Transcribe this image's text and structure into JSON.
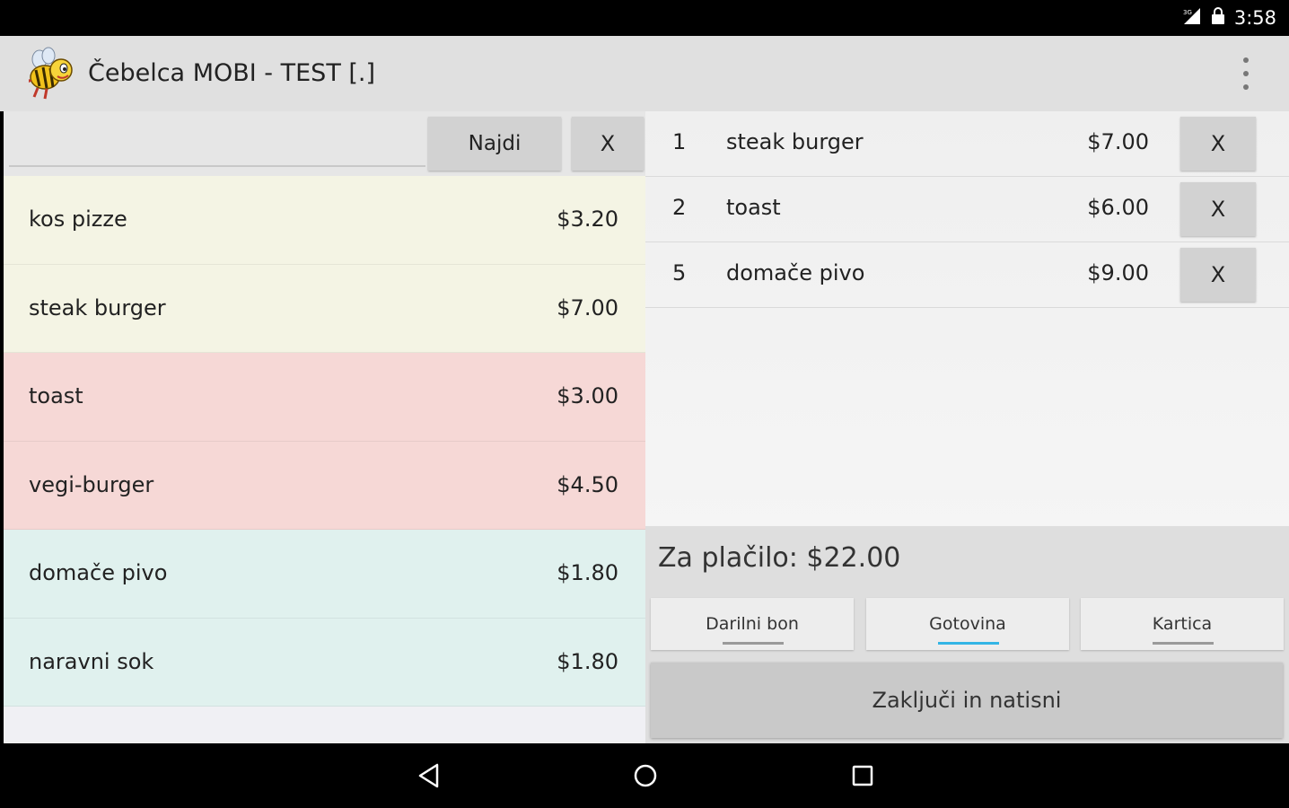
{
  "status_bar": {
    "time": "3:58",
    "signal_icon": "signal-icon",
    "lock_icon": "lock-icon"
  },
  "app_bar": {
    "title": "Čebelca MOBI - TEST [.]",
    "logo_icon": "bee-logo-icon",
    "menu_icon": "overflow-menu-icon"
  },
  "search": {
    "value": "",
    "placeholder": "",
    "find_label": "Najdi",
    "clear_label": "X"
  },
  "products": [
    {
      "name": "kos pizze",
      "price": "$3.20",
      "color": "#f4f4e4"
    },
    {
      "name": "steak burger",
      "price": "$7.00",
      "color": "#f4f4e4"
    },
    {
      "name": "toast",
      "price": "$3.00",
      "color": "#f6d8d6"
    },
    {
      "name": "vegi-burger",
      "price": "$4.50",
      "color": "#f6d8d6"
    },
    {
      "name": "domače pivo",
      "price": "$1.80",
      "color": "#e0f1ee"
    },
    {
      "name": "naravni sok",
      "price": "$1.80",
      "color": "#e0f1ee"
    }
  ],
  "order": {
    "items": [
      {
        "qty": "1",
        "name": "steak burger",
        "price": "$7.00",
        "delete_label": "X"
      },
      {
        "qty": "2",
        "name": "toast",
        "price": "$6.00",
        "delete_label": "X"
      },
      {
        "qty": "5",
        "name": "domače pivo",
        "price": "$9.00",
        "delete_label": "X"
      }
    ]
  },
  "payment": {
    "total_label": "Za plačilo: $22.00",
    "tabs": [
      {
        "label": "Darilni bon",
        "active": false
      },
      {
        "label": "Gotovina",
        "active": true
      },
      {
        "label": "Kartica",
        "active": false
      }
    ],
    "accent_color": "#33b5e5",
    "finish_label": "Zaključi in natisni"
  },
  "nav_bar": {
    "back_icon": "back-icon",
    "home_icon": "home-icon",
    "recents_icon": "recents-icon"
  }
}
